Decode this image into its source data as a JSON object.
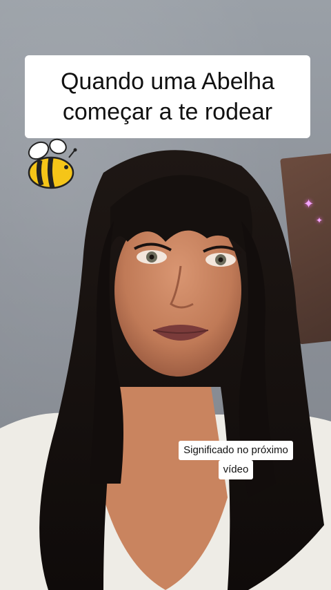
{
  "caption_top": {
    "text": "Quando uma Abelha\ncomeçar a te rodear"
  },
  "caption_bottom": {
    "line1": "Significado no próximo",
    "line2": "vídeo"
  },
  "sticker": {
    "icon": "bee-icon"
  },
  "colors": {
    "caption_bg": "#ffffff",
    "caption_text": "#111111",
    "bee_yellow": "#f5c518",
    "hair": "#17110f",
    "skin": "#c98563"
  }
}
